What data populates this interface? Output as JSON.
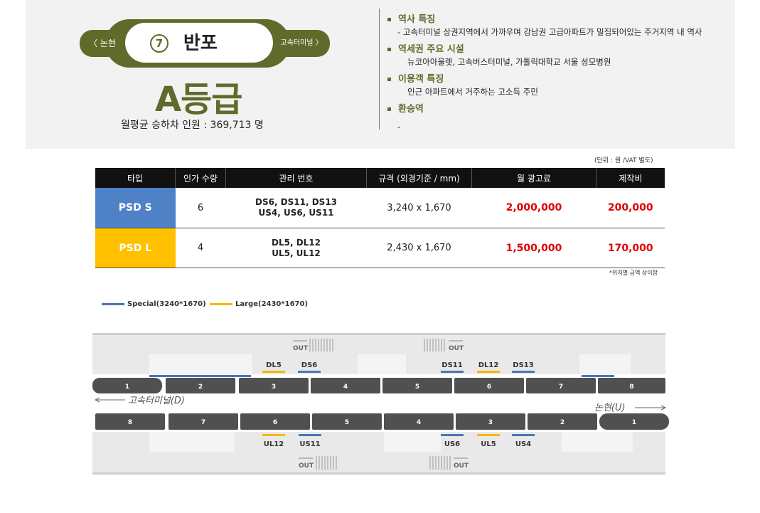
{
  "station": {
    "prev": "〈 논현",
    "number": "7",
    "name": "반포",
    "next": "고속터미널 〉",
    "grade": "A등급",
    "ridership": "월평균 승하차 인원 : 369,713 명"
  },
  "info": [
    {
      "title": "역사 특징",
      "desc": "-  고속터미널 상권지역에서 가까우며 강남권 고급아파트가 밀집되어있는 주거지역 내 역사"
    },
    {
      "title": "역세권 주요 시설",
      "desc": "뉴코아아울렛, 고속버스터미널, 가톨릭대학교 서울 성모병원"
    },
    {
      "title": "이용객 특징",
      "desc": "인근 아파트에서 거주하는 고소득 주민"
    },
    {
      "title": "환승역",
      "desc": "-"
    }
  ],
  "table": {
    "unit_note": "(단위 : 원 /VAT 별도)",
    "headers": [
      "타입",
      "인가 수량",
      "관리 번호",
      "규격 (외경기준 / mm)",
      "월 광고료",
      "제작비"
    ],
    "rows": [
      {
        "type": "PSD S",
        "type_color": "#4f81c7",
        "qty": "6",
        "codes1": "DS6, DS11, DS13",
        "codes2": "US4, US6, US11",
        "size": "3,240 x 1,670",
        "fee": "2,000,000",
        "cost": "200,000"
      },
      {
        "type": "PSD L",
        "type_color": "#ffc000",
        "qty": "4",
        "codes1": "DL5, DL12",
        "codes2": "UL5, UL12",
        "size": "2,430 x 1,670",
        "fee": "1,500,000",
        "cost": "170,000"
      }
    ],
    "foot_note": "*위치별 금액 상이함"
  },
  "legend": {
    "special": "Special(3240*1670)",
    "special_color": "#4f73b8",
    "large": "Large(2430*1670)",
    "large_color": "#f5b800"
  },
  "diagram": {
    "top_cars": [
      "1",
      "2",
      "3",
      "4",
      "5",
      "6",
      "7",
      "8"
    ],
    "bottom_cars": [
      "8",
      "7",
      "6",
      "5",
      "4",
      "3",
      "2",
      "1"
    ],
    "dir_down": "고속터미널(D)",
    "dir_up": "논현(U)",
    "out_label": "OUT",
    "top_labels": [
      {
        "text": "DL5",
        "kind": "large"
      },
      {
        "text": "DS6",
        "kind": "special"
      },
      {
        "text": "DS11",
        "kind": "special"
      },
      {
        "text": "DL12",
        "kind": "large"
      },
      {
        "text": "DS13",
        "kind": "special"
      }
    ],
    "bottom_labels": [
      {
        "text": "UL12",
        "kind": "large"
      },
      {
        "text": "US11",
        "kind": "special"
      },
      {
        "text": "US6",
        "kind": "special"
      },
      {
        "text": "UL5",
        "kind": "large"
      },
      {
        "text": "US4",
        "kind": "special"
      }
    ]
  }
}
